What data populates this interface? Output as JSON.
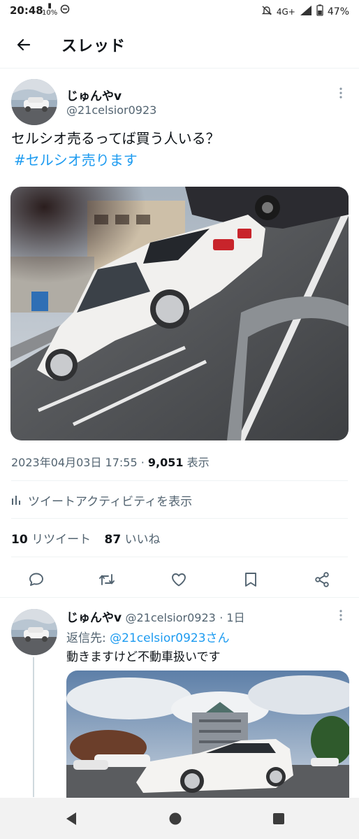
{
  "status_bar": {
    "time": "20:48",
    "data_saver": "10%",
    "network": "4G+",
    "battery": "47%"
  },
  "header": {
    "title": "スレッド"
  },
  "tweet": {
    "display_name": "じゅんやv",
    "handle": "@21celsior0923",
    "text": "セルシオ売るってば買う人いる？",
    "hashtag": "#セルシオ売ります",
    "timestamp": "2023年04月03日 17:55",
    "separator": "·",
    "views_count": "9,051",
    "views_label": "表示",
    "analytics_label": "ツイートアクティビティを表示",
    "retweets_count": "10",
    "retweets_label": "リツイート",
    "likes_count": "87",
    "likes_label": "いいね"
  },
  "reply": {
    "display_name": "じゅんやv",
    "handle": "@21celsior0923",
    "age": "· 1日",
    "reply_to_prefix": "返信先: ",
    "reply_to_handle": "@21celsior0923さん",
    "text": "動きますけど不動車扱いです"
  },
  "icons": [
    "back-arrow-icon",
    "more-icon",
    "bar-chart-icon",
    "reply-icon",
    "retweet-icon",
    "like-icon",
    "bookmark-icon",
    "share-icon",
    "nav-back-icon",
    "nav-home-icon",
    "nav-recents-icon"
  ],
  "colors": {
    "accent": "#1d9bf0",
    "secondary_text": "#536471",
    "primary_text": "#0f1419"
  }
}
